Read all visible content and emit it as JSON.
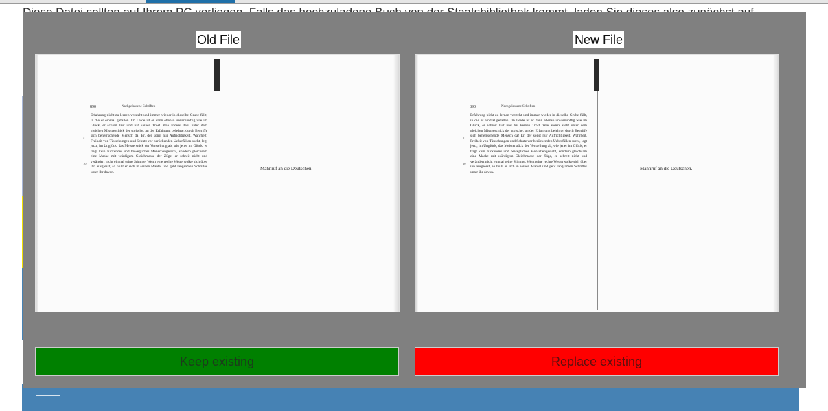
{
  "background": {
    "intro_text": "Diese Datei sollten auf Ihrem PC vorliegen. Falls das hochzuladene Buch von der Staatsbibliothek kommt, laden Sie dieses also zunächst auf"
  },
  "modal": {
    "old_label": "Old File",
    "new_label": "New File",
    "old_preview": {
      "page_number": "890",
      "running_head": "Nachgelassene Schriften",
      "body": "Erfahrung nicht zu lernen versteht und immer wieder in dieselbe Grube fällt, in die er einmal gefallen. Im Leide ist er dann ebenso unvernünftig wie im Glück, er schreit laut und hat keinen Trost. Wie anders steht unter dem gleichen Missgeschick der stoische, an der Erfahrung belehrte, durch Begriffe sich beherrschende Mensch da! Er, der sonst nur Aufrichtigkeit, Wahrheit, Freiheit von Täuschungen und Schutz vor berückenden Ueberfällen sucht, legt jetzt, im Unglück, das Meisterstück der Verstellung ab, wie jener im Glück; er trägt kein zuckendes und bewegliches Menschengesicht, sondern gleichsam eine Maske mit würdigem Gleichmasse der Züge, er schreit nicht und verändert nicht einmal seine Stimme. Wenn eine rechte Wetterwolke sich über ihn ausgiesst, so hüllt er sich in seinen Mantel und geht langsamen Schrittes unter ihr davon.",
      "line_5": "5",
      "line_10": "10",
      "right_caption": "Mahnruf an die Deutschen."
    },
    "new_preview": {
      "page_number": "890",
      "running_head": "Nachgelassene Schriften",
      "body": "Erfahrung nicht zu lernen versteht und immer wieder in dieselbe Grube fällt, in die er einmal gefallen. Im Leide ist er dann ebenso unvernünftig wie im Glück, er schreit laut und hat keinen Trost. Wie anders steht unter dem gleichen Missgeschick der stoische, an der Erfahrung belehrte, durch Begriffe sich beherrschende Mensch da! Er, der sonst nur Aufrichtigkeit, Wahrheit, Freiheit von Täuschungen und Schutz vor berückenden Ueberfällen sucht, legt jetzt, im Unglück, das Meisterstück der Verstellung ab, wie jener im Glück; er trägt kein zuckendes und bewegliches Menschengesicht, sondern gleichsam eine Maske mit würdigem Gleichmasse der Züge, er schreit nicht und verändert nicht einmal seine Stimme. Wenn eine rechte Wetterwolke sich über ihn ausgiesst, so hüllt er sich in seinen Mantel und geht langsamen Schrittes unter ihr davon.",
      "line_5": "5",
      "line_10": "10",
      "right_caption": "Mahnruf an die Deutschen."
    },
    "keep_label": "Keep existing",
    "replace_label": "Replace existing"
  },
  "colors": {
    "modal_bg": "#808080",
    "keep": "#008000",
    "replace": "#ff0000",
    "panel_blue": "#4682b4"
  }
}
